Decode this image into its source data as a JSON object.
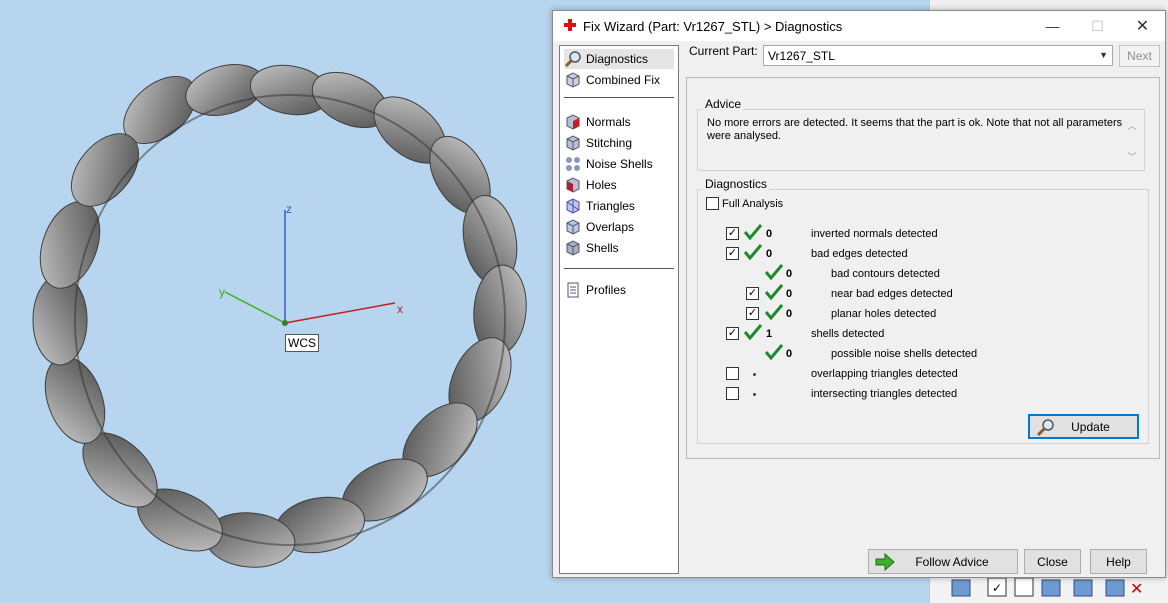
{
  "dialog": {
    "title": "Fix Wizard (Part: Vr1267_STL) > Diagnostics",
    "minimize": "—",
    "maximize": "☐",
    "close": "✕"
  },
  "viewport": {
    "wcs_label": "WCS",
    "axis_x": "x",
    "axis_y": "y",
    "axis_z": "z"
  },
  "nav": {
    "items": [
      {
        "label": "Diagnostics",
        "icon": "magnifier-icon"
      },
      {
        "label": "Combined Fix",
        "icon": "cube-icon"
      },
      {
        "label": "Normals",
        "icon": "normals-icon"
      },
      {
        "label": "Stitching",
        "icon": "stitching-icon"
      },
      {
        "label": "Noise Shells",
        "icon": "noise-shells-icon"
      },
      {
        "label": "Holes",
        "icon": "holes-icon"
      },
      {
        "label": "Triangles",
        "icon": "triangles-icon"
      },
      {
        "label": "Overlaps",
        "icon": "overlaps-icon"
      },
      {
        "label": "Shells",
        "icon": "shells-icon"
      },
      {
        "label": "Profiles",
        "icon": "document-icon"
      }
    ]
  },
  "current_part": {
    "label": "Current Part:",
    "value": "Vr1267_STL",
    "next": "Next"
  },
  "advice": {
    "label": "Advice",
    "text": "No more errors are detected. It seems that the part is ok. Note that not all parameters were analysed."
  },
  "diagnostics": {
    "label": "Diagnostics",
    "full_analysis": "Full Analysis",
    "rows": [
      {
        "count": "0",
        "text": "inverted normals detected"
      },
      {
        "count": "0",
        "text": "bad edges detected"
      },
      {
        "count": "0",
        "text": "bad contours detected"
      },
      {
        "count": "0",
        "text": "near bad edges detected"
      },
      {
        "count": "0",
        "text": "planar holes detected"
      },
      {
        "count": "1",
        "text": "shells detected"
      },
      {
        "count": "0",
        "text": "possible noise shells detected"
      },
      {
        "count": "",
        "text": "overlapping triangles detected"
      },
      {
        "count": "",
        "text": "intersecting triangles detected"
      }
    ],
    "update": "Update"
  },
  "footer": {
    "follow_advice": "Follow Advice",
    "close": "Close",
    "help": "Help"
  },
  "colors": {
    "viewport_bg": "#b7d5ef",
    "check_green": "#1a8a2a",
    "accent_blue": "#0078d7"
  }
}
